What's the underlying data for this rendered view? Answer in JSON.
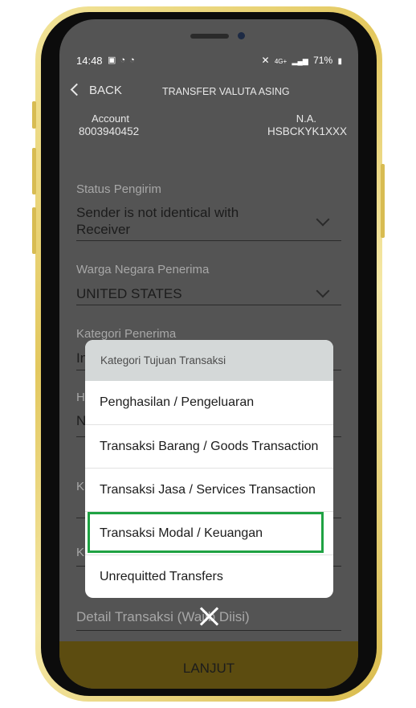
{
  "status_bar": {
    "time": "14:48",
    "left_icons": "▣ ◔ ◔",
    "mute_icon": "✕",
    "network": "4G+",
    "signal": "▂▄▆",
    "battery": "71%",
    "battery_icon": "▮"
  },
  "header": {
    "back_label": "BACK",
    "title": "TRANSFER VALUTA ASING",
    "account_label": "Account",
    "account_number": "8003940452",
    "na_label": "N.A.",
    "swift_code": "HSBCKYK1XXX"
  },
  "form": {
    "status_label": "Status Pengirim",
    "status_value_line1": "Sender is not identical with",
    "status_value_line2": "Receiver",
    "citizenship_label": "Warga Negara Penerima",
    "citizenship_value": "UNITED STATES",
    "recipient_category_label": "Kategori Penerima",
    "recipient_category_value_partial": "In",
    "relationship_label_partial": "H",
    "relationship_value_partial": "N",
    "field_k1_partial": "K",
    "field_k2_partial": "K",
    "detail_label": "Detail Transaksi (Wajib Diisi)"
  },
  "footer": {
    "next_label": "LANJUT"
  },
  "modal": {
    "title": "Kategori Tujuan Transaksi",
    "options": [
      "Penghasilan / Pengeluaran",
      "Transaksi Barang / Goods Transaction",
      "Transaksi Jasa / Services Transaction",
      "Transaksi Modal / Keuangan",
      "Unrequitted Transfers"
    ],
    "highlighted_option": "Transaksi Modal / Keuangan"
  },
  "colors": {
    "highlight": "#1fa243",
    "phone_frame": "#e3c85f",
    "overlay": "#545454"
  }
}
